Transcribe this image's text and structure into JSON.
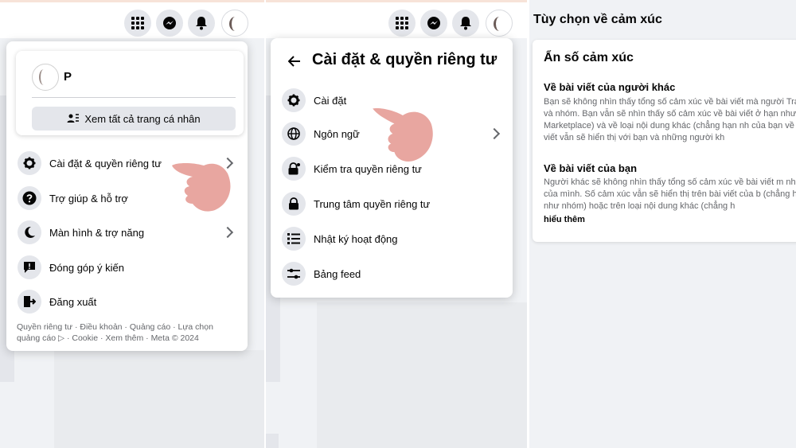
{
  "panel1": {
    "profile": {
      "name": "P"
    },
    "see_all_profiles": "Xem tất cả trang cá nhân",
    "menu": [
      {
        "label": "Cài đặt & quyền riêng tư",
        "icon": "gear-icon",
        "has_chevron": true
      },
      {
        "label": "Trợ giúp & hỗ trợ",
        "icon": "question-icon",
        "has_chevron": false
      },
      {
        "label": "Màn hình & trợ năng",
        "icon": "moon-icon",
        "has_chevron": true
      },
      {
        "label": "Đóng góp ý kiến",
        "icon": "feedback-icon",
        "has_chevron": false
      },
      {
        "label": "Đăng xuất",
        "icon": "logout-icon",
        "has_chevron": false
      }
    ],
    "footer": "Quyền riêng tư · Điều khoản · Quảng cáo · Lựa chọn quảng cáo ▷ · Cookie · Xem thêm · Meta © 2024"
  },
  "panel2": {
    "title": "Cài đặt & quyền riêng tư",
    "menu": [
      {
        "label": "Cài đặt",
        "icon": "gear-icon"
      },
      {
        "label": "Ngôn ngữ",
        "icon": "globe-icon"
      },
      {
        "label": "Kiểm tra quyền riêng tư",
        "icon": "lock-heart-icon"
      },
      {
        "label": "Trung tâm quyền riêng tư",
        "icon": "lock-icon"
      },
      {
        "label": "Nhật ký hoạt động",
        "icon": "list-icon"
      },
      {
        "label": "Bảng feed",
        "icon": "sliders-icon"
      }
    ]
  },
  "panel3": {
    "heading": "Tùy chọn về cảm xúc",
    "card_title": "Ẩn số cảm xúc",
    "section1": {
      "title": "Về bài viết của người khác",
      "text": "Bạn sẽ không nhìn thấy tổng số cảm xúc về bài viết mà người Trang và nhóm. Bạn vẫn sẽ nhìn thấy số cảm xúc về bài viết ở hạn như Marketplace) và về loại nội dung khác (chẳng hạn nh của bạn về bài viết vẫn sẽ hiển thị với bạn và những người kh"
    },
    "section2": {
      "title": "Về bài viết của bạn",
      "text": "Người khác sẽ không nhìn thấy tổng số cảm xúc về bài viết m nhân của mình. Số cảm xúc vẫn sẽ hiển thị trên bài viết của b (chẳng hạn như nhóm) hoặc trên loại nội dung khác (chẳng h",
      "link": "hiểu thêm"
    }
  },
  "colors": {
    "page_bg": "#f0f2f5",
    "icon_bg": "#e4e6eb",
    "text_primary": "#050505",
    "text_secondary": "#65676b",
    "hand": "#e8a6a0"
  }
}
